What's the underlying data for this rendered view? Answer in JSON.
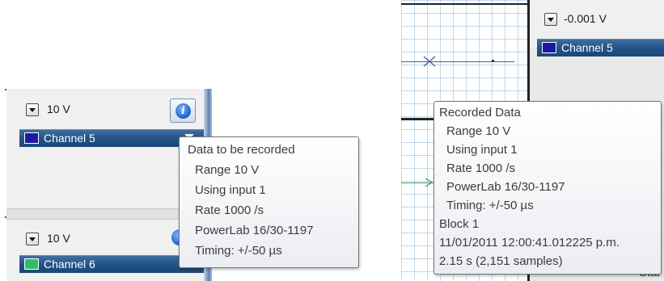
{
  "left_panel": {
    "range1": "10 V",
    "channel1": {
      "label": "Channel 5",
      "color": "#1a1aa0"
    },
    "range2": "10 V",
    "channel2": {
      "label": "Channel 6",
      "color": "#2fbf6a"
    },
    "tooltip": {
      "title": "Data to be recorded",
      "lines": [
        "Range 10 V",
        "Using input 1",
        "Rate 1000 /s",
        "PowerLab 16/30-1197",
        "Timing: +/-50 µs"
      ]
    }
  },
  "right_panel": {
    "range": "-0.001 V",
    "channel": {
      "label": "Channel 5",
      "color": "#1a1aa0"
    },
    "tooltip": {
      "title": "Recorded Data",
      "lines": [
        "Range 10 V",
        "Using input 1",
        "Rate 1000 /s",
        "PowerLab 16/30-1197",
        "Timing: +/-50 µs"
      ],
      "block": "Block 1",
      "timestamp": "11/01/2011 12:00:41.012225 p.m.",
      "duration": "2.15 s (2,151 samples)"
    },
    "partial_button_text": "Star"
  }
}
